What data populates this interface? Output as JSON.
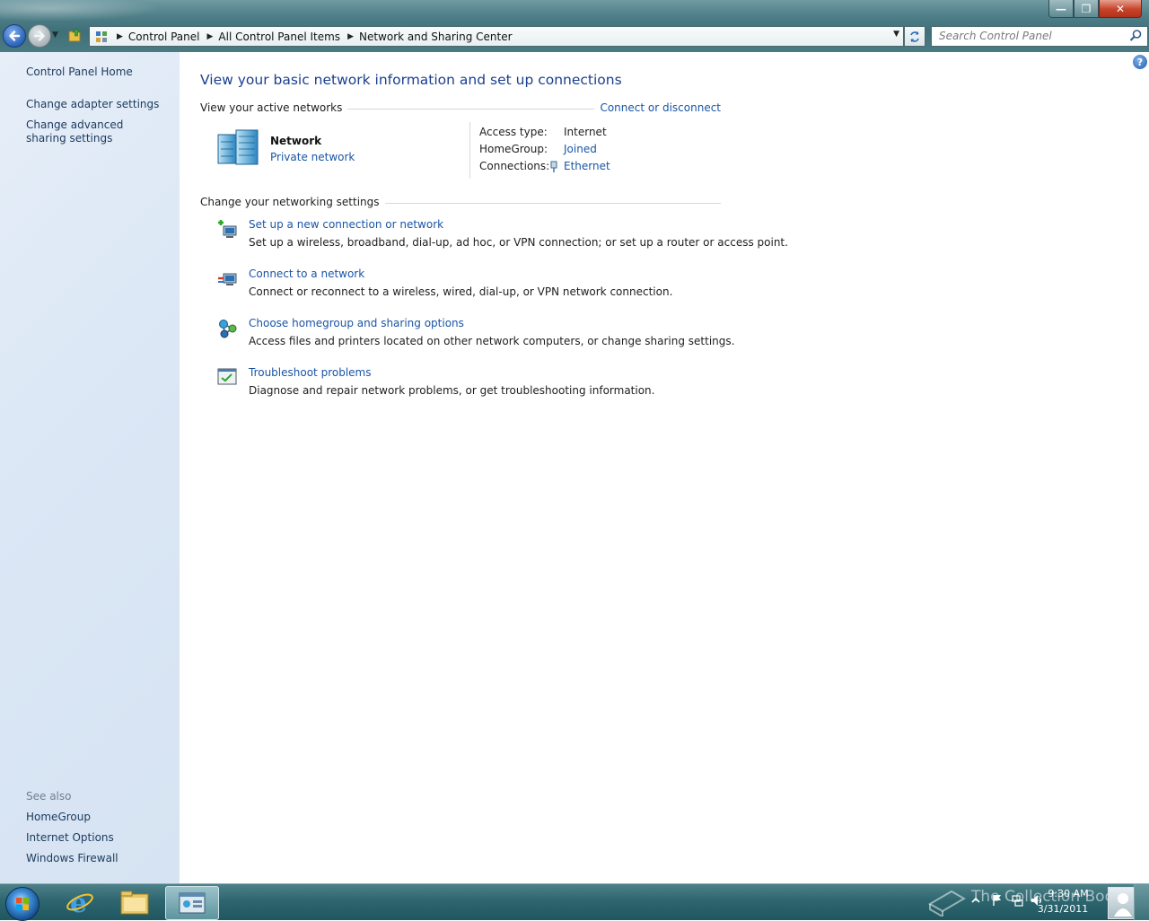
{
  "window": {
    "buttons": {
      "minimize": "—",
      "restore": "❐",
      "close": "✕"
    }
  },
  "addressbar": {
    "crumbs": [
      "Control Panel",
      "All Control Panel Items",
      "Network and Sharing Center"
    ],
    "search_placeholder": "Search Control Panel"
  },
  "sidebar": {
    "items": [
      {
        "label": "Control Panel Home"
      },
      {
        "label": "Change adapter settings"
      },
      {
        "label": "Change advanced sharing settings"
      }
    ],
    "see_also_label": "See also",
    "see_also": [
      {
        "label": "HomeGroup"
      },
      {
        "label": "Internet Options"
      },
      {
        "label": "Windows Firewall"
      }
    ]
  },
  "main": {
    "title": "View your basic network information and set up connections",
    "active_networks": {
      "heading": "View your active networks",
      "connect_link": "Connect or disconnect",
      "network_name": "Network",
      "network_type": "Private network",
      "access_type_label": "Access type:",
      "access_type_value": "Internet",
      "homegroup_label": "HomeGroup:",
      "homegroup_value": "Joined",
      "connections_label": "Connections:",
      "connections_value": "Ethernet"
    },
    "settings": {
      "heading": "Change your networking settings",
      "tasks": [
        {
          "title": "Set up a new connection or network",
          "desc": "Set up a wireless, broadband, dial-up, ad hoc, or VPN connection; or set up a router or access point.",
          "icon": "new-connection-icon"
        },
        {
          "title": "Connect to a network",
          "desc": "Connect or reconnect to a wireless, wired, dial-up, or VPN network connection.",
          "icon": "connect-network-icon"
        },
        {
          "title": "Choose homegroup and sharing options",
          "desc": "Access files and printers located on other network computers, or change sharing settings.",
          "icon": "homegroup-icon"
        },
        {
          "title": "Troubleshoot problems",
          "desc": "Diagnose and repair network problems, or get troubleshooting information.",
          "icon": "troubleshoot-icon"
        }
      ]
    }
  },
  "taskbar": {
    "time": "9:30 AM",
    "date": "3/31/2011",
    "watermark": "The Collection Book"
  },
  "colors": {
    "link": "#1a55a5",
    "title": "#1a3f8f",
    "sidebar_bg": "#dbe7f5"
  }
}
